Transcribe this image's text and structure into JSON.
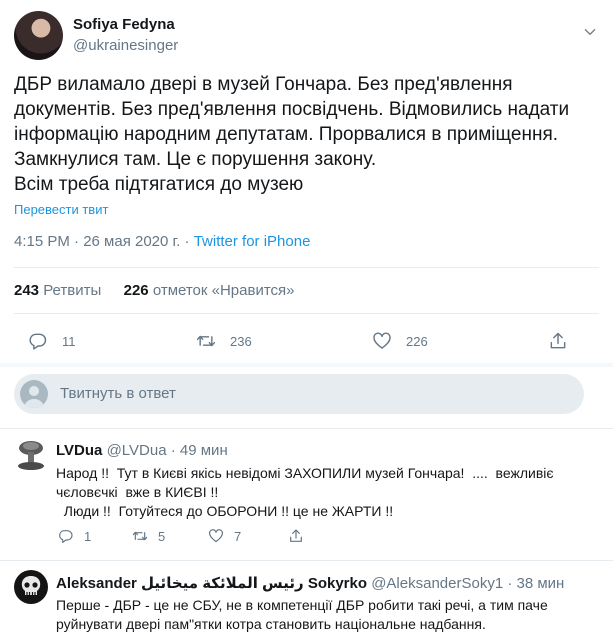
{
  "tweet": {
    "author_name": "Sofiya Fedyna",
    "author_handle": "@ukrainesinger",
    "lines": [
      "ДБР виламало двері в музей Гончара. Без пред'явлення",
      "документів. Без пред'явлення посвідчень. Відмовились надати",
      "інформацію народним депутатам. Прорвалися в приміщення.",
      "Замкнулися там. Це є порушення закону.",
      "Всім треба підтягатися до музею"
    ],
    "translate_label": "Перевести твит",
    "timestamp": "4:15 PM · 26 мая 2020 г.",
    "source": "Twitter for iPhone",
    "retweets_count": "243",
    "retweets_label": "Ретвиты",
    "likes_count": "226",
    "likes_label": "отметок «Нравится»",
    "actions": {
      "reply": "11",
      "retweet": "236",
      "like": "226"
    }
  },
  "compose": {
    "placeholder": "Твитнуть в ответ"
  },
  "replies": [
    {
      "name": "LVDua",
      "handle": "@LVDua",
      "time": "· 49 мин",
      "body": "Народ !!  Тут в Києві якісь невідомі ЗАХОПИЛИ музей Гончара!  ....  вежливіє\nчєловєчкі  вже в КИЄВІ !!\n  Люди !!  Готуйтеся до ОБОРОНИ !! це не ЖАРТИ !!",
      "reply_count": "1",
      "retweet_count": "5",
      "like_count": "7"
    },
    {
      "name": "Aleksander رئيس الملائكة ميخائيل Sokyrko",
      "handle": "@AleksanderSoky1",
      "time": "· 38 мин",
      "body": "Перше - ДБР - це не СБУ, не в компетенції ДБР робити такі речі, а тим паче\nруйнувати двері пам\"ятки котра становить національне надбання."
    }
  ],
  "colors": {
    "accent": "#1da1f2",
    "link": "#1b95e0",
    "muted": "#657786",
    "divider": "#e6ecf0"
  }
}
